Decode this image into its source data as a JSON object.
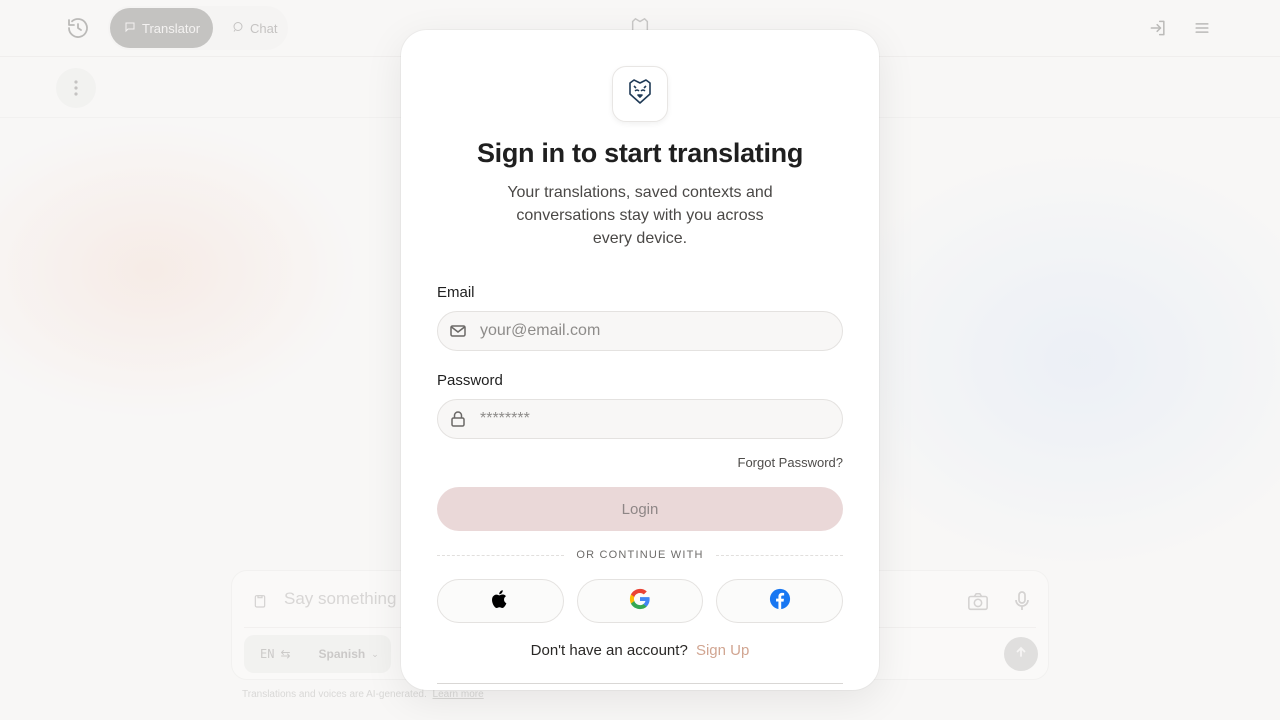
{
  "nav": {
    "tabs": [
      {
        "label": "Translator",
        "active": true
      },
      {
        "label": "Chat",
        "active": false
      }
    ]
  },
  "composer": {
    "placeholder": "Say something",
    "source_lang": "EN",
    "target_lang": "Spanish",
    "disclaimer": "Translations and voices are AI-generated.",
    "learn_more": "Learn more"
  },
  "modal": {
    "title": "Sign in to start translating",
    "subtitle": "Your translations, saved contexts and conversations stay with you across every device.",
    "email_label": "Email",
    "email_placeholder": "your@email.com",
    "password_label": "Password",
    "password_placeholder": "********",
    "forgot": "Forgot Password?",
    "login": "Login",
    "divider": "OR CONTINUE WITH",
    "social": [
      {
        "name": "apple-icon"
      },
      {
        "name": "google-icon"
      },
      {
        "name": "facebook-icon"
      }
    ],
    "signup_prompt": "Don't have an account?",
    "signup_link": "Sign Up"
  },
  "colors": {
    "accent_link": "#d1a591",
    "login_button": "#ead8d8",
    "facebook": "#1877f2"
  }
}
